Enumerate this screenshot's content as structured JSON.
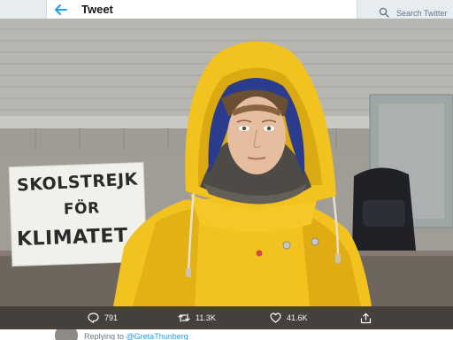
{
  "header": {
    "title": "Tweet",
    "search_placeholder": "Search Twitter"
  },
  "photo": {
    "sign_lines": [
      "SKOLSTREJK",
      "FÖR",
      "KLIMATET"
    ]
  },
  "actions": {
    "replies": "791",
    "retweets": "11.3K",
    "likes": "41.6K"
  },
  "reply": {
    "prefix": "Replying to",
    "mention": "@GretaThunberg"
  },
  "colors": {
    "accent": "#1da1f2",
    "action_bar": "#46403c",
    "raincoat": "#f2c21e"
  }
}
